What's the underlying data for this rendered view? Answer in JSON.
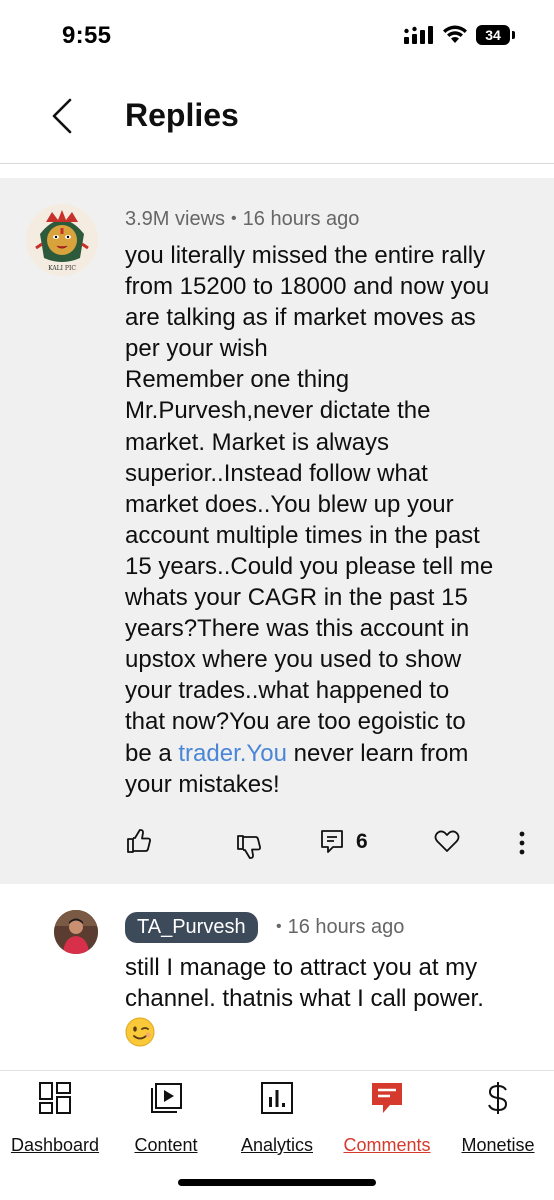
{
  "status_bar": {
    "time": "9:55",
    "battery": "34"
  },
  "header": {
    "title": "Replies"
  },
  "parent_comment": {
    "views": "3.9M views",
    "time": "16 hours ago",
    "text_lines": [
      "you literally missed the entire rally",
      "from 15200 to 18000 and now you",
      "are talking as if market moves as",
      "per your wish",
      "Remember one thing",
      "Mr.Purvesh,never dictate the",
      "market. Market is always",
      "superior..Instead follow what",
      "market does..You blew up your",
      "account multiple times in the past",
      "15 years..Could you please tell me",
      "whats your CAGR in the past 15",
      "years?There was this account in",
      "upstox where you used to show",
      "your trades..what happened to",
      "that now?You are too egoistic to"
    ],
    "line_pre_link": "be a ",
    "link_text": "trader.You",
    "line_post_link": " never learn from",
    "last_line": "your mistakes!",
    "avatar_caption": "KALI PIC",
    "reply_count": "6"
  },
  "reply": {
    "author": "TA_Purvesh",
    "time": "16 hours ago",
    "text_lines": [
      "still I manage to attract you at my",
      "channel. thatnis what I call power."
    ]
  },
  "bottom_nav": {
    "items": [
      {
        "label": "Dashboard",
        "icon": "dashboard-icon"
      },
      {
        "label": "Content",
        "icon": "content-icon"
      },
      {
        "label": "Analytics",
        "icon": "analytics-icon"
      },
      {
        "label": "Comments",
        "icon": "comments-icon",
        "active": true
      },
      {
        "label": "Monetise",
        "icon": "monetise-icon"
      }
    ],
    "active_color": "#d63a2c"
  },
  "colors": {
    "link": "#4a86d8",
    "chip_bg": "#3d4a5a",
    "comment_bg": "#f0f0f0"
  }
}
